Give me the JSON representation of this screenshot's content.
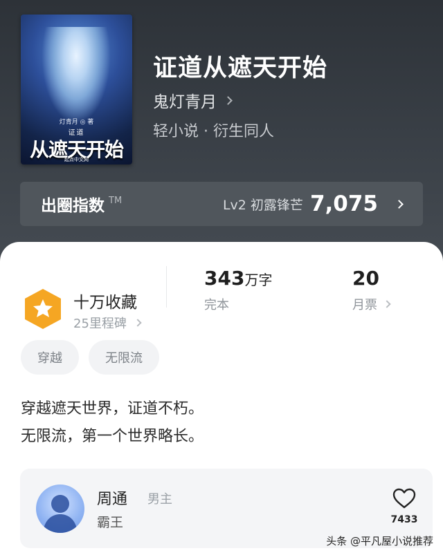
{
  "book": {
    "title": "证道从遮天开始",
    "author": "鬼灯青月",
    "genre": "轻小说 · 衍生同人",
    "cover": {
      "author_line": "灯青月 ◎ 著",
      "title_small": "证道",
      "title_big": "从遮天开始",
      "publisher": "起点中文网"
    }
  },
  "index": {
    "label": "出圈指数",
    "tm": "TM",
    "level": "Lv2 初露锋芒",
    "value": "7,075"
  },
  "milestone": {
    "title": "十万收藏",
    "sub": "25里程碑"
  },
  "stats": {
    "words_num": "343",
    "words_unit": "万字",
    "words_label": "完本",
    "tickets_num": "20",
    "tickets_label": "月票"
  },
  "tags": [
    "穿越",
    "无限流"
  ],
  "description": [
    "穿越遮天世界，证道不朽。",
    "无限流，第一个世界略长。"
  ],
  "character": {
    "name": "周通",
    "role": "男主",
    "title": "霸王",
    "likes": "7433"
  },
  "watermark": "头条 @平凡屋小说推荐",
  "colors": {
    "badge": "#f5a623",
    "card_bg": "#ffffff",
    "hero_bg": "#3a4047"
  }
}
